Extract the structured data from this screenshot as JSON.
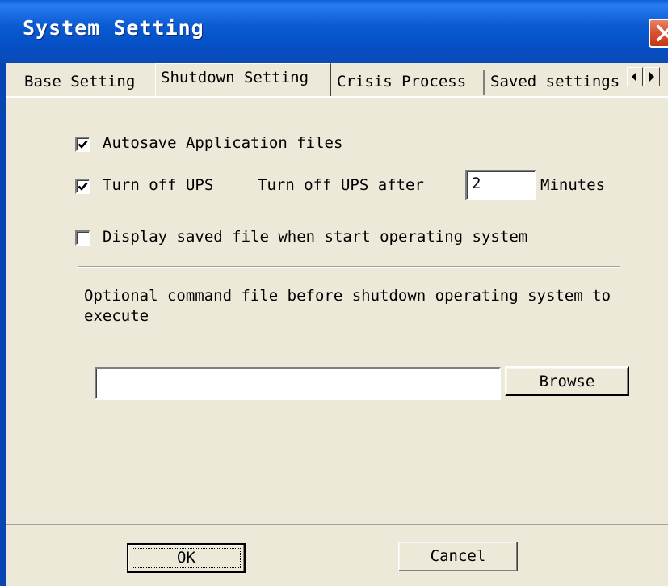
{
  "window": {
    "title": "System Setting"
  },
  "tabs": [
    {
      "label": "Base Setting"
    },
    {
      "label": "Shutdown Setting"
    },
    {
      "label": "Crisis Process"
    },
    {
      "label": "Saved settings"
    }
  ],
  "options": {
    "autosave": {
      "label": "Autosave Application files",
      "checked": true
    },
    "turn_off_ups": {
      "label": "Turn off UPS",
      "checked": true,
      "after_label": "Turn off UPS after",
      "minutes_value": "2",
      "minutes_label": "Minutes"
    },
    "display_saved": {
      "label": "Display saved file when start operating system",
      "checked": false
    }
  },
  "command": {
    "description": "Optional command file before shutdown operating system to execute",
    "path_value": "",
    "browse_label": "Browse"
  },
  "footer": {
    "ok_label": "OK",
    "cancel_label": "Cancel"
  },
  "colors": {
    "titlebar": "#0550c6",
    "dialog_bg": "#ece9d8",
    "close": "#d9502d"
  }
}
